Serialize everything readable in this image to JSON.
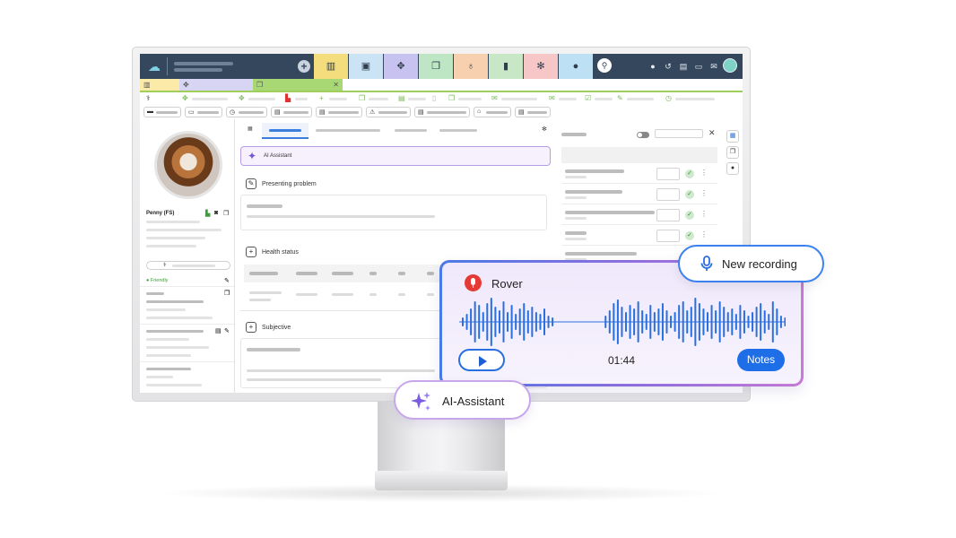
{
  "emr_screen": {
    "tabs": [
      "",
      "",
      ""
    ],
    "patient": {
      "name": "Penny (FS)",
      "status": "Friendly"
    },
    "ai_assistant_bar_label": "AI Assistant",
    "sections": {
      "presenting_problem": "Presenting problem",
      "health_status": "Health status",
      "subjective": "Subjective"
    }
  },
  "recording_card": {
    "recording_name": "Rover",
    "duration": "01:44",
    "notes_button_label": "Notes"
  },
  "new_recording_button_label": "New recording",
  "ai_assistant_pill_label": "AI-Assistant",
  "colors": {
    "topbar": "#34475d",
    "accent_blue": "#1e6ee8",
    "ai_purple": "#7557d6",
    "record_red": "#e53935",
    "nav_tabs": [
      "#f4dd7c",
      "#cbe4f5",
      "#c7c2ef",
      "#bfe6c4",
      "#f7d0b0",
      "#c8e7c6",
      "#f7c6c6",
      "#bde0f4"
    ]
  },
  "icons": {
    "logo": "cloud-icon",
    "nav": [
      "calendar-icon",
      "contact-card-icon",
      "paw-icon",
      "copy-icon",
      "money-bag-icon",
      "bar-chart-icon",
      "gear-icon",
      "help-icon"
    ]
  }
}
